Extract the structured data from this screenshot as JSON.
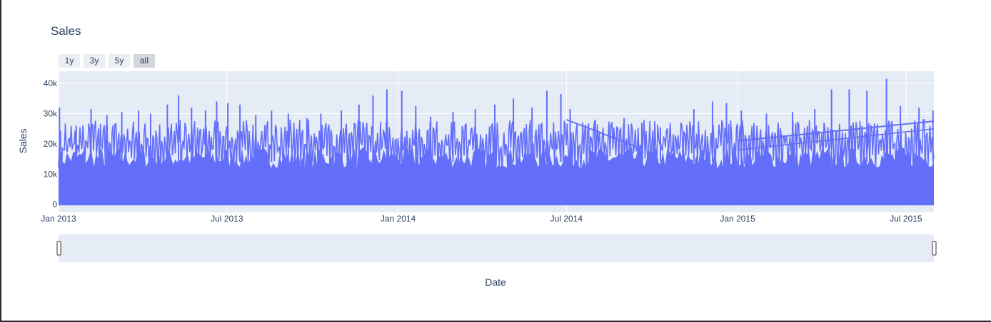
{
  "chart_data": {
    "type": "line",
    "title": "Sales",
    "xlabel": "Date",
    "ylabel": "Sales",
    "x_range": [
      "2013-01-01",
      "2015-07-31"
    ],
    "ylim": [
      0,
      42000
    ],
    "x_ticks": [
      "Jan 2013",
      "Jul 2013",
      "Jan 2014",
      "Jul 2014",
      "Jan 2015",
      "Jul 2015"
    ],
    "x_tick_dates": [
      "2013-01-01",
      "2013-07-01",
      "2014-01-01",
      "2014-07-01",
      "2015-01-01",
      "2015-07-01"
    ],
    "y_ticks": [
      "0",
      "10k",
      "20k",
      "30k",
      "40k"
    ],
    "y_tick_values": [
      0,
      10000,
      20000,
      30000,
      40000
    ],
    "grid": true,
    "range_selector": [
      "1y",
      "3y",
      "5y",
      "all"
    ],
    "range_selector_active": "all",
    "range_slider": true,
    "series": [
      {
        "color": "#636efa",
        "dense": true,
        "sample_daily_peaks": [
          [
            "2013-01-02",
            32000
          ],
          [
            "2013-01-20",
            26000
          ],
          [
            "2013-02-05",
            31500
          ],
          [
            "2013-02-22",
            29500
          ],
          [
            "2013-03-10",
            30500
          ],
          [
            "2013-03-28",
            31000
          ],
          [
            "2013-04-10",
            30000
          ],
          [
            "2013-04-28",
            33000
          ],
          [
            "2013-05-10",
            36000
          ],
          [
            "2013-05-24",
            32000
          ],
          [
            "2013-06-08",
            31000
          ],
          [
            "2013-06-20",
            34000
          ],
          [
            "2013-07-02",
            33500
          ],
          [
            "2013-07-15",
            33000
          ],
          [
            "2013-08-01",
            29500
          ],
          [
            "2013-08-18",
            31000
          ],
          [
            "2013-09-05",
            30000
          ],
          [
            "2013-09-25",
            28500
          ],
          [
            "2013-10-10",
            30000
          ],
          [
            "2013-11-01",
            31000
          ],
          [
            "2013-11-20",
            33000
          ],
          [
            "2013-12-05",
            36000
          ],
          [
            "2013-12-20",
            38000
          ],
          [
            "2014-01-05",
            37500
          ],
          [
            "2014-01-20",
            32500
          ],
          [
            "2014-02-05",
            29000
          ],
          [
            "2014-03-01",
            30500
          ],
          [
            "2014-03-25",
            31500
          ],
          [
            "2014-04-15",
            33000
          ],
          [
            "2014-05-05",
            35000
          ],
          [
            "2014-05-25",
            32000
          ],
          [
            "2014-06-10",
            37500
          ],
          [
            "2014-06-25",
            36500
          ],
          [
            "2014-07-05",
            31500
          ],
          [
            "2014-08-01",
            28000
          ],
          [
            "2014-09-01",
            28500
          ],
          [
            "2014-09-20",
            27000
          ],
          [
            "2014-10-10",
            25500
          ],
          [
            "2014-11-15",
            31500
          ],
          [
            "2014-12-05",
            34000
          ],
          [
            "2014-12-20",
            33500
          ],
          [
            "2015-01-05",
            31000
          ],
          [
            "2015-02-01",
            30000
          ],
          [
            "2015-03-01",
            30500
          ],
          [
            "2015-03-25",
            31500
          ],
          [
            "2015-04-12",
            38000
          ],
          [
            "2015-05-01",
            38000
          ],
          [
            "2015-05-20",
            37500
          ],
          [
            "2015-06-10",
            41500
          ],
          [
            "2015-06-25",
            32500
          ],
          [
            "2015-07-15",
            32000
          ],
          [
            "2015-07-30",
            31000
          ]
        ]
      }
    ]
  },
  "colors": {
    "plot_bg": "#e5ecf6",
    "grid": "#ffffff",
    "line": "#636efa",
    "text": "#2a3f5f"
  }
}
